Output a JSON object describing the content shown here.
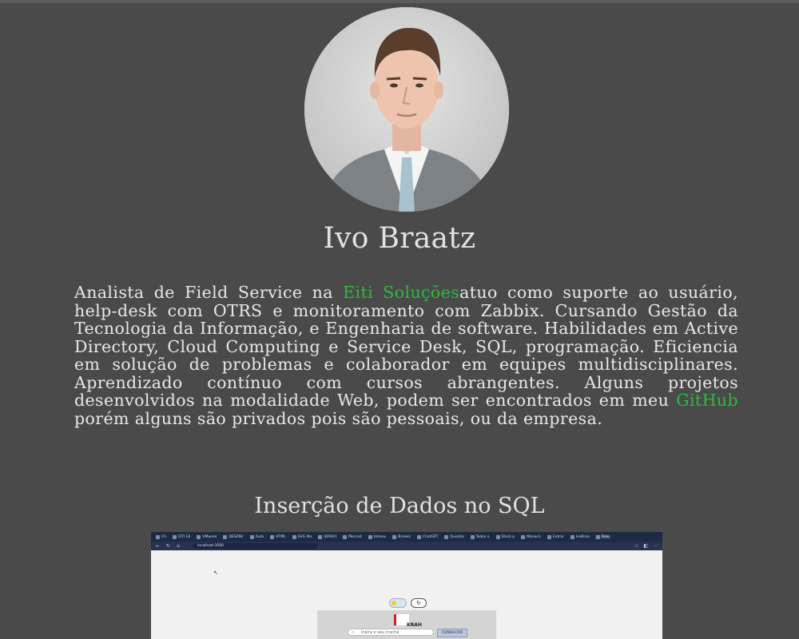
{
  "profile": {
    "name": "Ivo Braatz",
    "bio": {
      "part1": "Analista de Field Service na ",
      "company_link": "Eiti Soluções",
      "part2": "atuo como suporte ao usuário, help-desk com OTRS e monitoramento com Zabbix. Cursando Gestão da Tecnologia da Informação, e Engenharia de software. Habilidades em Active Directory, Cloud Computing e Service Desk, SQL, programação. Eficiencia em solução de problemas e colaborador em equipes multidisciplinares. Aprendizado contínuo com cursos abrangentes. Alguns projetos desenvolvidos na modalidade Web, podem ser encontrados em meu ",
      "github_link": "GitHub",
      "part3": " porém alguns são privados pois são pessoais, ou da empresa."
    }
  },
  "projects": [
    {
      "title": "Inserção de Dados no SQL",
      "screenshot": {
        "tabs": [
          "Ch",
          "EITI Ed",
          "VMware",
          "DESENV",
          "Auto",
          "HTML",
          "SVG Mo",
          "[KRAH]",
          "Mercad",
          "timeou",
          "Breaez",
          "ChatGPT",
          "Questio",
          "Todos o",
          "Stock p",
          "Monaco",
          "Entrar",
          "IvoBraa",
          "Relo"
        ],
        "address": "localhost:3000",
        "logo_text": "KRAH",
        "input_placeholder": "Insira o seu crachá",
        "button_label": "CONSULTAR",
        "refresh_glyph": "↻"
      }
    }
  ],
  "colors": {
    "background": "#4a4a4a",
    "text": "#e6e6e6",
    "link": "#2dbb3b"
  }
}
